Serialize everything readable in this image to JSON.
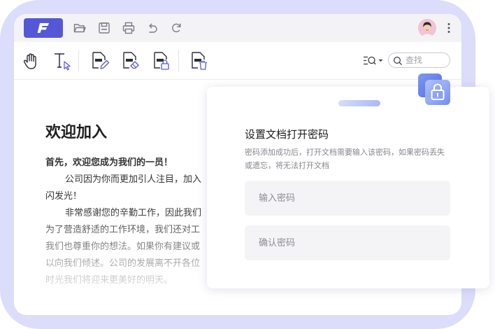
{
  "colors": {
    "frame": "#dcdcfb",
    "accent": "#5458d6",
    "titlebar": "#f3f3f6",
    "field_bg": "#f4f4f6"
  },
  "titlebar": {
    "logo_letter": "F",
    "icons": [
      "app-logo-icon",
      "folder-open-icon",
      "save-icon",
      "print-icon",
      "undo-icon",
      "redo-icon",
      "avatar",
      "more-vertical-icon"
    ]
  },
  "toolbar": {
    "tools": [
      "hand-icon",
      "text-select-icon",
      "edit-document-icon",
      "erase-document-icon",
      "lock-document-icon",
      "delete-document-icon"
    ],
    "search": {
      "placeholder": "查找",
      "value": ""
    }
  },
  "document": {
    "title": "欢迎加入",
    "lines": [
      "首先，欢迎您成为我们的一员！",
      "公司因为你而更加引人注目，加入",
      "闪发光！",
      "非常感谢您的辛勤工作，因此我们",
      "为了营造舒适的工作环境，我们还对工",
      "我们也尊重你的想法。如果你有建议或",
      "以向我们倾述。公司的发展离不开各位",
      "时光我们将迎来更美好的明天。"
    ]
  },
  "password_panel": {
    "title": "设置文档打开密码",
    "description": "密码添加成功后，打开文档需要输入该密码，如果密码丢失或遗忘，将无法打开文档",
    "password_placeholder": "输入密码",
    "confirm_placeholder": "确认密码"
  }
}
